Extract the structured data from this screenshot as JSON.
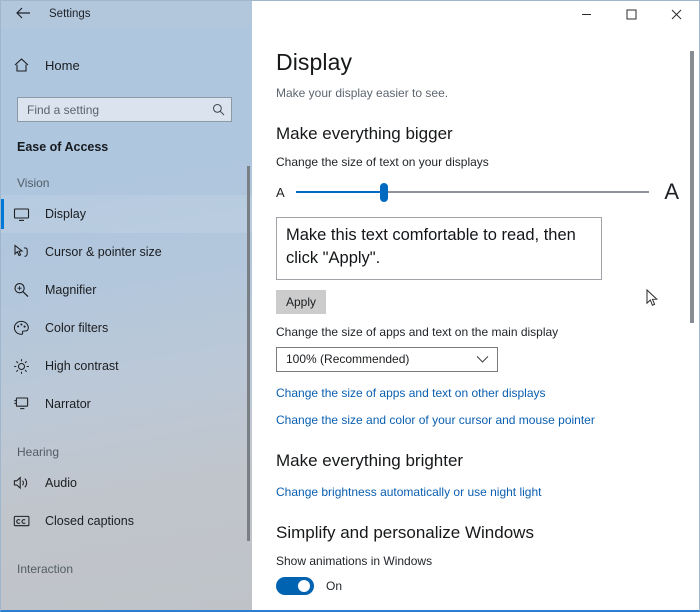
{
  "window": {
    "app_title": "Settings",
    "back_icon": "back-arrow-icon",
    "controls": {
      "minimize": "minimize-icon",
      "maximize": "maximize-icon",
      "close": "close-icon"
    }
  },
  "sidebar": {
    "home_label": "Home",
    "home_icon": "home-icon",
    "search": {
      "placeholder": "Find a setting",
      "value": "",
      "icon": "search-icon"
    },
    "category": "Ease of Access",
    "groups": [
      {
        "title": "Vision",
        "items": [
          {
            "label": "Display",
            "icon": "monitor-icon",
            "selected": true
          },
          {
            "label": "Cursor & pointer size",
            "icon": "cursor-pointer-icon",
            "selected": false
          },
          {
            "label": "Magnifier",
            "icon": "magnifier-icon",
            "selected": false
          },
          {
            "label": "Color filters",
            "icon": "color-palette-icon",
            "selected": false
          },
          {
            "label": "High contrast",
            "icon": "brightness-icon",
            "selected": false
          },
          {
            "label": "Narrator",
            "icon": "narrator-icon",
            "selected": false
          }
        ]
      },
      {
        "title": "Hearing",
        "items": [
          {
            "label": "Audio",
            "icon": "speaker-icon",
            "selected": false
          },
          {
            "label": "Closed captions",
            "icon": "closed-captions-icon",
            "selected": false
          }
        ]
      },
      {
        "title": "Interaction",
        "items": []
      }
    ]
  },
  "main": {
    "title": "Display",
    "subtitle": "Make your display easier to see.",
    "sections": {
      "bigger": {
        "heading": "Make everything bigger",
        "text_size_label": "Change the size of text on your displays",
        "slider": {
          "min_glyph": "A",
          "max_glyph": "A",
          "value_percent": 25
        },
        "preview_text": "Make this text comfortable to read, then click \"Apply\".",
        "apply_label": "Apply",
        "scale_label": "Change the size of apps and text on the main display",
        "scale_value": "100% (Recommended)",
        "scale_chevron": "chevron-down-icon",
        "link_other_displays": "Change the size of apps and text on other displays",
        "link_cursor_pointer": "Change the size and color of your cursor and mouse pointer"
      },
      "brighter": {
        "heading": "Make everything brighter",
        "link_brightness": "Change brightness automatically or use night light"
      },
      "simplify": {
        "heading": "Simplify and personalize Windows",
        "animations_label": "Show animations in Windows",
        "animations_state": "On"
      }
    }
  },
  "colors": {
    "accent": "#0078d7",
    "link": "#0b5fb0",
    "toggle_on": "#0063b1",
    "sidebar_top": "#aec6de",
    "titlebar_left": "#b2c7dc"
  }
}
